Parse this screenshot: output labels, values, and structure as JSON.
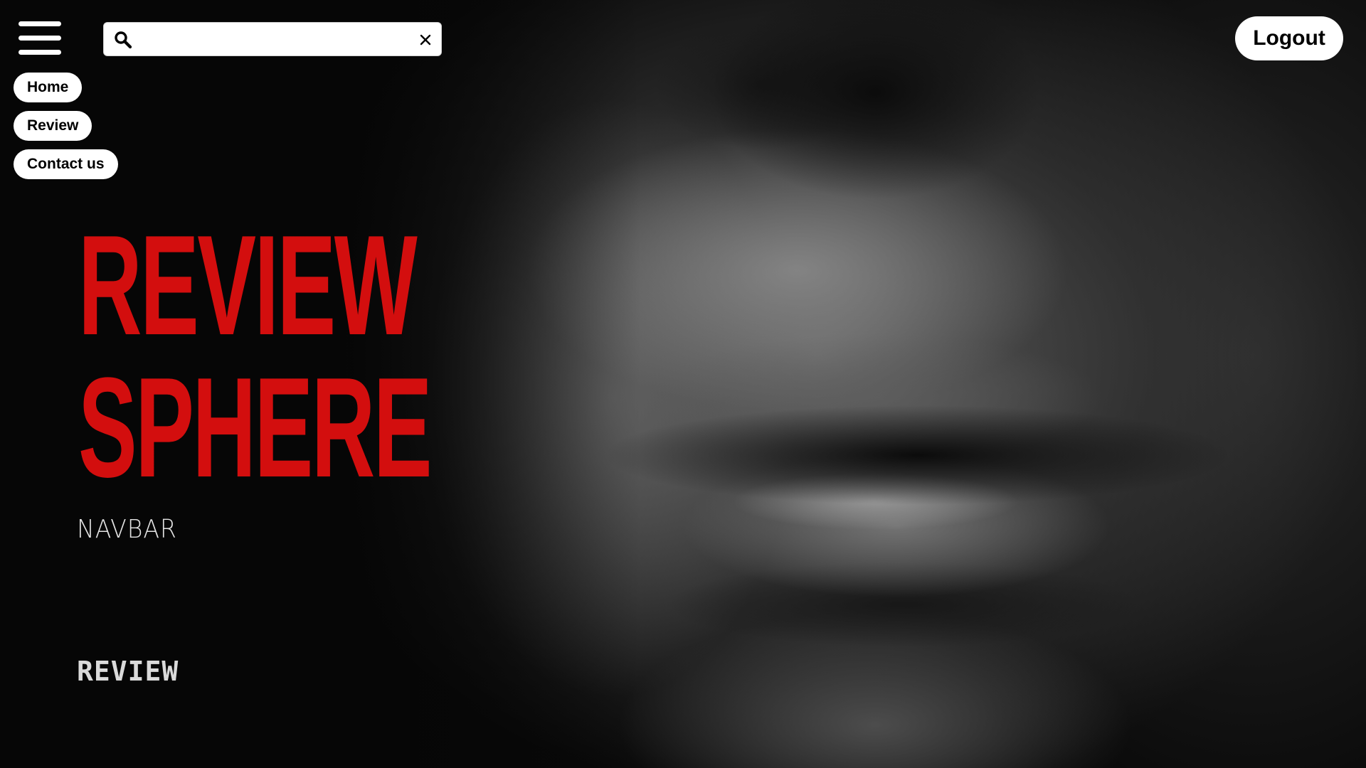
{
  "header": {
    "menu_icon": "hamburger-menu-icon",
    "search": {
      "placeholder": "",
      "value": "",
      "search_icon": "magnifier-icon",
      "clear_icon": "close-x-icon"
    },
    "logout_label": "Logout"
  },
  "nav": {
    "items": [
      {
        "label": "Home"
      },
      {
        "label": "Review"
      },
      {
        "label": "Contact us"
      }
    ]
  },
  "hero": {
    "title_line1": "REVIEW",
    "title_line2": "SPHERE",
    "subtitle": "NAVBAR",
    "section_link": "REVIEW"
  },
  "colors": {
    "accent_red": "#d30e0e",
    "background": "#080808",
    "pill_background": "#ffffff",
    "pill_text": "#000000"
  }
}
